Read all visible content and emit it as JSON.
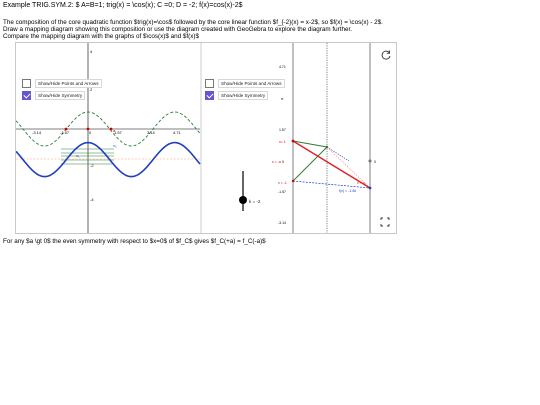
{
  "header": {
    "title": "Example TRIG.SYM.2: $ A=B=1; trig(x) = \\cos(x); C =0; D = -2; f(x)=cos(x)-2$",
    "intro": [
      "The composition of the core quadratic function $trig(x)=\\cos$ followed by the core linear function $f_{-2}(x) = x-2$, so $f(x) = \\cos(x) - 2$.",
      "Draw a mapping diagram showing this composition or use the diagram created with GeoGebra to explore the diagram further.",
      "Compare the mapping diagram with the graphs of $\\cos(x)$ and $f(x)$"
    ],
    "footer": "For any $a \\gt 0$ the even symmetry with respect to $x=0$ of $f_C$ gives $f_C(+a) = f_C(-a)$"
  },
  "controls": {
    "left_arrows_label": "Show/Hide Points and Arrows",
    "left_symmetry_label": "Show/Hide Symmetry",
    "right_arrows_label": "Show/Hide Points and Arrows",
    "right_symmetry_label": "Show/Hide Symmetry",
    "left_arrows_checked": false,
    "left_symmetry_checked": true,
    "right_arrows_checked": false,
    "right_symmetry_checked": true,
    "slider_label": "k = -2",
    "slider_value": -2
  },
  "graph_panel": {
    "x_ticks": [
      "-3.14",
      "-1.57",
      "0",
      "1.57",
      "3.14",
      "4.71"
    ],
    "y_ticks": [
      "4",
      "2",
      "-2",
      "-4"
    ],
    "point_labels": [
      "x₁",
      "x₂",
      "a"
    ],
    "colors": {
      "cos_curve": "#2e7d32",
      "f_curve": "#1f3fbf",
      "axis": "#000000",
      "dashed": "#ff9966",
      "points": "#cc0000"
    }
  },
  "mapping_panel": {
    "axis_ticks_left": [
      "4.71",
      "π",
      "1.57",
      "0",
      "-1.57",
      "-3.14"
    ],
    "axis_labels": [
      "x= 1",
      "x = -a",
      "0",
      "x = a",
      "x = -1",
      "0"
    ],
    "value_label": "f(x) = -1.46",
    "colors": {
      "red_arrow": "#dd2222",
      "green_arrow": "#2e7d32",
      "blue_dash": "#1f3fbf",
      "pink_dash": "#ff8888"
    }
  }
}
